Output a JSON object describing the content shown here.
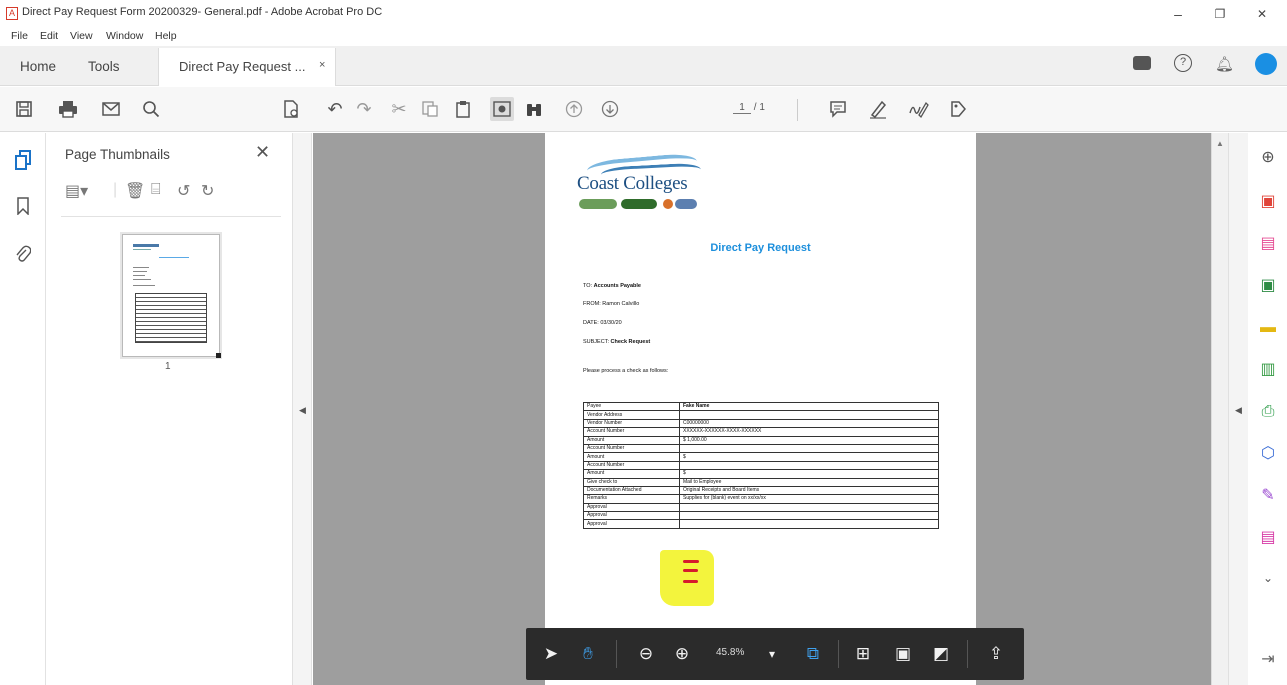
{
  "window": {
    "title": "Direct Pay Request Form 20200329- General.pdf - Adobe Acrobat Pro DC",
    "controls": {
      "minimize": "–",
      "restore": "❐",
      "close": "✕"
    }
  },
  "menu": [
    "File",
    "Edit",
    "View",
    "Window",
    "Help"
  ],
  "tabs": {
    "home": "Home",
    "tools": "Tools",
    "doc_tab": "Direct Pay Request ...",
    "doc_tab_close": "×"
  },
  "toolbar": {
    "page_current": "1",
    "page_total": "/ 1"
  },
  "thumbnails_panel": {
    "title": "Page Thumbnails",
    "close": "✕",
    "page_label": "1"
  },
  "document": {
    "logo_text": "Coast Colleges",
    "heading": "Direct Pay Request",
    "to_label": "TO:",
    "to_value": "Accounts Payable",
    "from_label": "FROM:",
    "from_value": "Ramon Calvillo",
    "date_label": "DATE:",
    "date_value": "03/30/20",
    "subject_label": "SUBJECT:",
    "subject_value": "Check Request",
    "instruction": "Please process a check as follows:",
    "rows": [
      {
        "label": "Payee",
        "value": "Fake Name"
      },
      {
        "label": "Vendor Address",
        "value": ""
      },
      {
        "label": "Vendor Number",
        "value": "C00000000"
      },
      {
        "label": "Account Number",
        "value": "XXXXXX-XXXXXX-XXXX-XXXXXX"
      },
      {
        "label": "Amount",
        "value": "$ 1,000.00"
      },
      {
        "label": "Account Number",
        "value": ""
      },
      {
        "label": "Amount",
        "value": "$"
      },
      {
        "label": "Account Number",
        "value": ""
      },
      {
        "label": "Amount",
        "value": "$"
      },
      {
        "label": "Give check to",
        "value": "Mail to Employee"
      },
      {
        "label": "Documentation Attached",
        "value": "Original Receipts and Board Items"
      },
      {
        "label": "Remarks",
        "value": "Supplies for (blank) event on xx/xx/xx"
      },
      {
        "label": "Approval",
        "value": ""
      },
      {
        "label": "Approval",
        "value": ""
      },
      {
        "label": "Approval",
        "value": ""
      }
    ]
  },
  "zoom": {
    "value": "45.8%"
  },
  "colors": {
    "accent": "#1d8fdc",
    "highlight": "#f1f21b",
    "doc_bg": "#9e9e9e",
    "zoombar": "#2b2b2b"
  }
}
